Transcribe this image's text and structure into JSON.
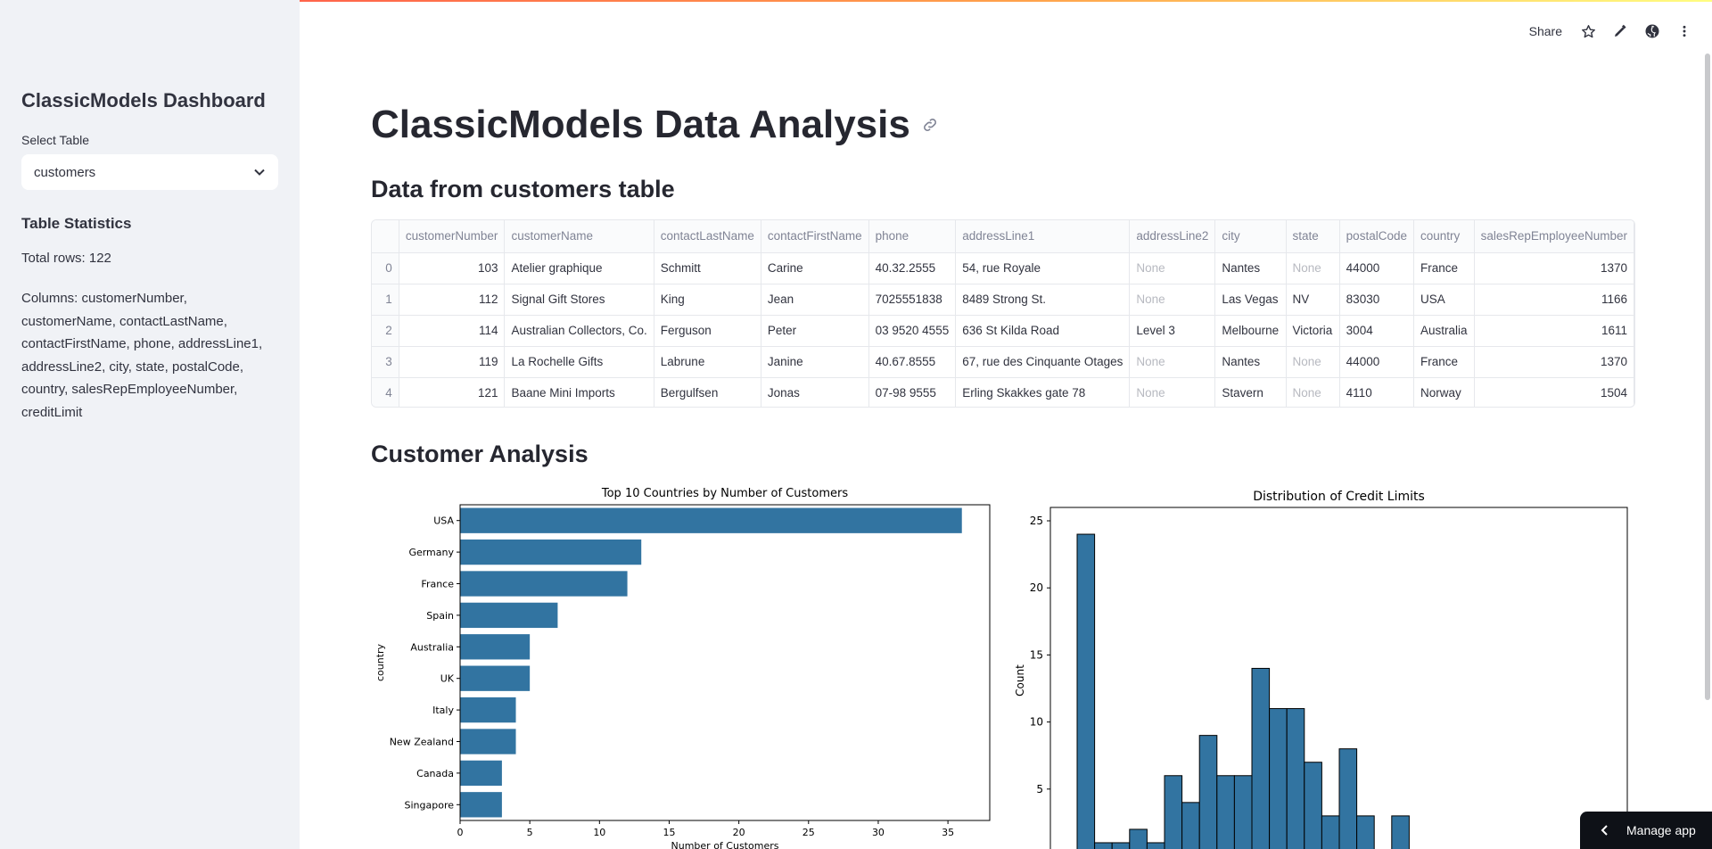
{
  "sidebar": {
    "title": "ClassicModels Dashboard",
    "select_label": "Select Table",
    "select_value": "customers",
    "stats_title": "Table Statistics",
    "total_rows": "Total rows: 122",
    "columns_text": "Columns: customerNumber, customerName, contactLastName, contactFirstName, phone, addressLine1, addressLine2, city, state, postalCode, country, salesRepEmployeeNumber, creditLimit"
  },
  "header": {
    "share_label": "Share",
    "icons": [
      "star-icon",
      "pencil-icon",
      "github-icon",
      "more-vertical-icon"
    ]
  },
  "main": {
    "title": "ClassicModels Data Analysis",
    "data_heading": "Data from customers table",
    "analysis_heading": "Customer Analysis"
  },
  "table": {
    "columns": [
      "",
      "customerNumber",
      "customerName",
      "contactLastName",
      "contactFirstName",
      "phone",
      "addressLine1",
      "addressLine2",
      "city",
      "state",
      "postalCode",
      "country",
      "salesRepEmployeeNumber"
    ],
    "rows": [
      [
        "0",
        "103",
        "Atelier graphique",
        "Schmitt",
        "Carine",
        "40.32.2555",
        "54, rue Royale",
        "None",
        "Nantes",
        "None",
        "44000",
        "France",
        "1370"
      ],
      [
        "1",
        "112",
        "Signal Gift Stores",
        "King",
        "Jean",
        "7025551838",
        "8489 Strong St.",
        "None",
        "Las Vegas",
        "NV",
        "83030",
        "USA",
        "1166"
      ],
      [
        "2",
        "114",
        "Australian Collectors, Co.",
        "Ferguson",
        "Peter",
        "03 9520 4555",
        "636 St Kilda Road",
        "Level 3",
        "Melbourne",
        "Victoria",
        "3004",
        "Australia",
        "1611"
      ],
      [
        "3",
        "119",
        "La Rochelle Gifts",
        "Labrune",
        "Janine",
        "40.67.8555",
        "67, rue des Cinquante Otages",
        "None",
        "Nantes",
        "None",
        "44000",
        "France",
        "1370"
      ],
      [
        "4",
        "121",
        "Baane Mini Imports",
        "Bergulfsen",
        "Jonas",
        "07-98 9555",
        "Erling Skakkes gate 78",
        "None",
        "Stavern",
        "None",
        "4110",
        "Norway",
        "1504"
      ]
    ]
  },
  "chart_data": [
    {
      "type": "bar",
      "orientation": "horizontal",
      "title": "Top 10 Countries by Number of Customers",
      "xlabel": "Number of Customers",
      "ylabel": "country",
      "categories": [
        "USA",
        "Germany",
        "France",
        "Spain",
        "Australia",
        "UK",
        "Italy",
        "New Zealand",
        "Canada",
        "Singapore"
      ],
      "values": [
        36,
        13,
        12,
        7,
        5,
        5,
        4,
        4,
        3,
        3
      ],
      "xlim": [
        0,
        38
      ],
      "xticks": [
        0,
        5,
        10,
        15,
        20,
        25,
        30,
        35
      ],
      "color": "#3274a1"
    },
    {
      "type": "bar",
      "subtype": "histogram",
      "title": "Distribution of Credit Limits",
      "xlabel": "",
      "ylabel": "Count",
      "values": [
        24,
        1,
        1,
        2,
        1,
        6,
        4,
        9,
        6,
        6,
        14,
        11,
        11,
        7,
        3,
        8,
        3,
        0,
        3,
        0,
        0,
        0,
        0,
        0,
        0,
        0,
        0,
        0,
        0,
        0,
        0,
        0,
        0,
        0,
        0,
        0,
        0,
        1
      ],
      "ylim": [
        0,
        25
      ],
      "yticks": [
        0,
        5,
        10,
        15,
        20,
        25
      ],
      "color": "#3274a1"
    }
  ],
  "manage_app_label": "Manage app"
}
